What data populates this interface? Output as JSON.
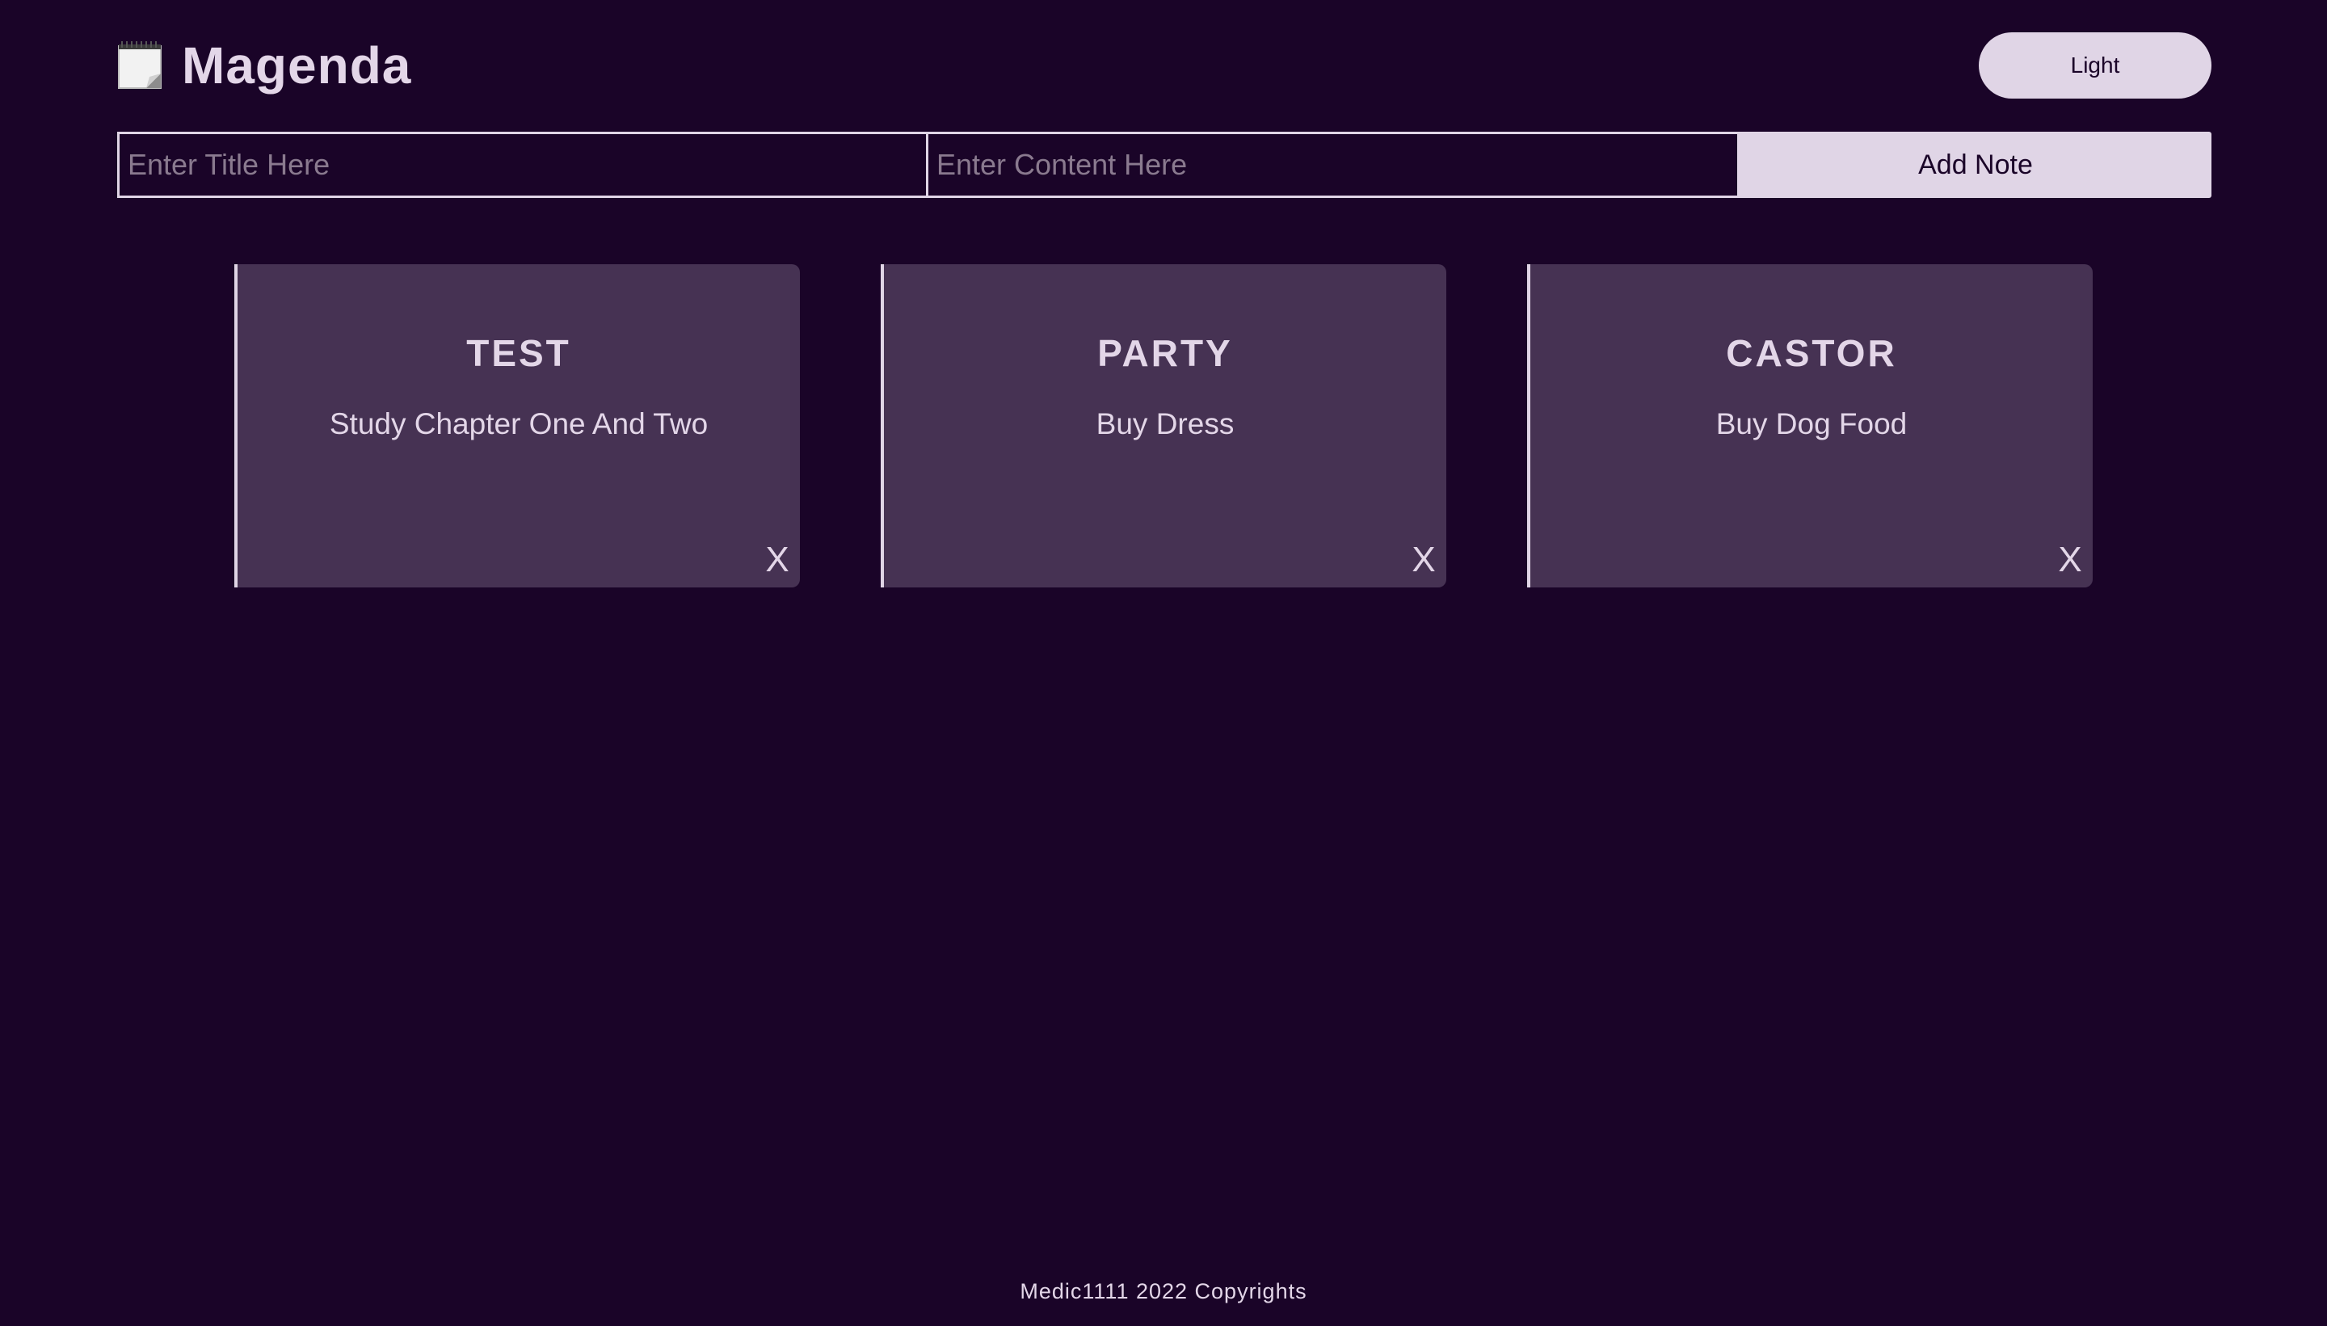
{
  "header": {
    "icon": "notepad-icon",
    "title": "Magenda",
    "theme_button_label": "Light"
  },
  "form": {
    "title_placeholder": "Enter Title Here",
    "content_placeholder": "Enter Content Here",
    "add_button_label": "Add Note"
  },
  "notes": [
    {
      "title": "TEST",
      "content": "Study Chapter One And Two",
      "delete_label": "X"
    },
    {
      "title": "PARTY",
      "content": "Buy Dress",
      "delete_label": "X"
    },
    {
      "title": "CASTOR",
      "content": "Buy Dog Food",
      "delete_label": "X"
    }
  ],
  "footer": {
    "text": "Medic1111 2022 Copyrights"
  },
  "colors": {
    "background": "#1a0428",
    "card": "#463253",
    "accent": "#e0d5e6",
    "text": "#e3d6e8"
  }
}
